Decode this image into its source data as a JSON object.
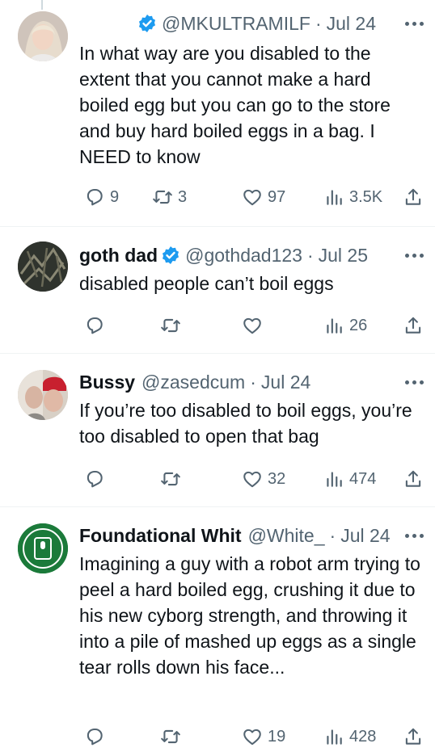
{
  "tweets": [
    {
      "name": "",
      "verified": true,
      "handle": "@MKULTRAMILF",
      "dot": "·",
      "date": "Jul 24",
      "text": "In what way are you disabled to the extent that you cannot make a hard boiled egg but you can go to the store and buy hard boiled eggs in a bag. I NEED to know",
      "replies": "9",
      "retweets": "3",
      "likes": "97",
      "views": "3.5K"
    },
    {
      "name": "goth dad",
      "verified": true,
      "handle": "@gothdad123",
      "dot": "·",
      "date": "Jul 25",
      "text": "disabled people can’t boil eggs",
      "replies": "",
      "retweets": "",
      "likes": "",
      "views": "26"
    },
    {
      "name": "Bussy",
      "verified": false,
      "handle": "@zasedcum",
      "dot": "·",
      "date": "Jul 24",
      "text": "If you’re too disabled to boil eggs, you’re too disabled to open that bag",
      "replies": "",
      "retweets": "",
      "likes": "32",
      "views": "474"
    },
    {
      "name": "Foundational Whit",
      "verified": false,
      "handle": "@White_",
      "dot": "·",
      "date": "Jul 24",
      "text": "Imagining a guy with a robot arm trying to peel a hard boiled egg, crushing it due to his new cyborg strength, and throwing it into a pile of mashed up eggs as a single tear rolls down his face...",
      "replies": "",
      "retweets": "",
      "likes": "19",
      "views": "428"
    }
  ],
  "icons": {
    "verified": "verified-badge-icon",
    "reply": "reply-icon",
    "retweet": "retweet-icon",
    "like": "like-icon",
    "views": "views-icon",
    "share": "share-icon",
    "more": "more-icon"
  },
  "colors": {
    "verified": "#1d9bf0",
    "muted": "#536471",
    "text": "#0f1419",
    "avatar4": "#1b7a3a"
  }
}
